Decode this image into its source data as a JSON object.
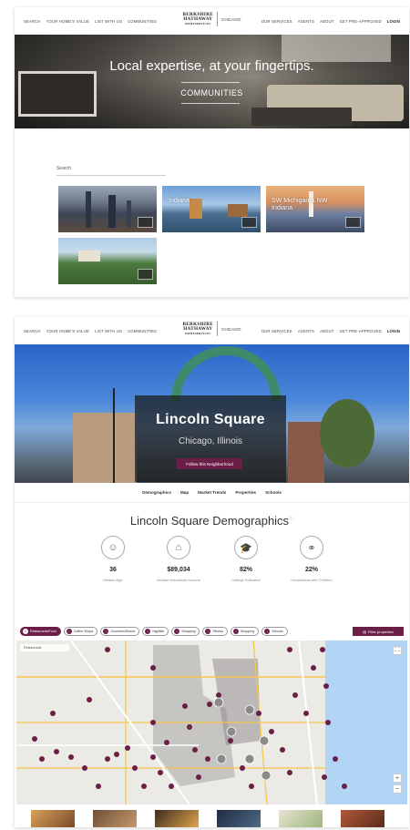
{
  "nav1": {
    "left": [
      "SEARCH",
      "YOUR HOME'S VALUE",
      "LIST WITH US",
      "COMMUNITIES"
    ],
    "right": [
      "OUR SERVICES",
      "AGENTS",
      "ABOUT",
      "GET PRE-APPROVED"
    ],
    "login": "LOGIN",
    "logo_lines": [
      "BERKSHIRE",
      "HATHAWAY",
      "HOMESERVICES"
    ],
    "logo_city": "CHICAGO"
  },
  "hero1": {
    "title": "Local expertise, at your fingertips.",
    "communities_label": "COMMUNITIES"
  },
  "search": {
    "label": "Search"
  },
  "tiles": [
    {
      "label": "",
      "key": "chicago"
    },
    {
      "label": "Indiana",
      "key": "indiana"
    },
    {
      "label": "SW Michigan & NW Indiana",
      "key": "michigan"
    },
    {
      "label": "",
      "key": "nw"
    }
  ],
  "nav2": {
    "left": [
      "SEARCH",
      "YOUR HOME'S VALUE",
      "LIST WITH US",
      "COMMUNITIES"
    ],
    "right": [
      "OUR SERVICES",
      "AGENTS",
      "ABOUT",
      "GET PRE-APPROVED"
    ],
    "login": "LOGIN",
    "logo_lines": [
      "BERKSHIRE",
      "HATHAWAY",
      "HOMESERVICES"
    ],
    "logo_city": "CHICAGO"
  },
  "hero2": {
    "title": "Lincoln Square",
    "subtitle": "Chicago, Illinois",
    "button": "Follow this Neighborhood"
  },
  "subnav": [
    "Demographics",
    "Map",
    "Market Trends",
    "Properties",
    "Schools"
  ],
  "demographics": {
    "title": "Lincoln Square Demographics",
    "stats": [
      {
        "icon": "people-icon",
        "glyph": "☺",
        "value": "36",
        "label": "Median Age"
      },
      {
        "icon": "house-icon",
        "glyph": "⌂",
        "value": "$89,034",
        "label": "Median Household Income"
      },
      {
        "icon": "graduation-cap-icon",
        "glyph": "🎓",
        "value": "82%",
        "label": "College Educated"
      },
      {
        "icon": "family-icon",
        "glyph": "⚭",
        "value": "22%",
        "label": "Households with Children"
      }
    ]
  },
  "filters": {
    "chips": [
      "Restaurants/Food",
      "Coffee Shops",
      "Groceries/Stores",
      "Nightlife",
      "Shopping",
      "Fitness",
      "Shopping",
      "Schools"
    ],
    "filter_button": "Filter properties"
  },
  "map": {
    "tab_label": "Restaurants"
  },
  "colors": {
    "brand": "#6b1f47",
    "lake": "#b2d4f5"
  }
}
